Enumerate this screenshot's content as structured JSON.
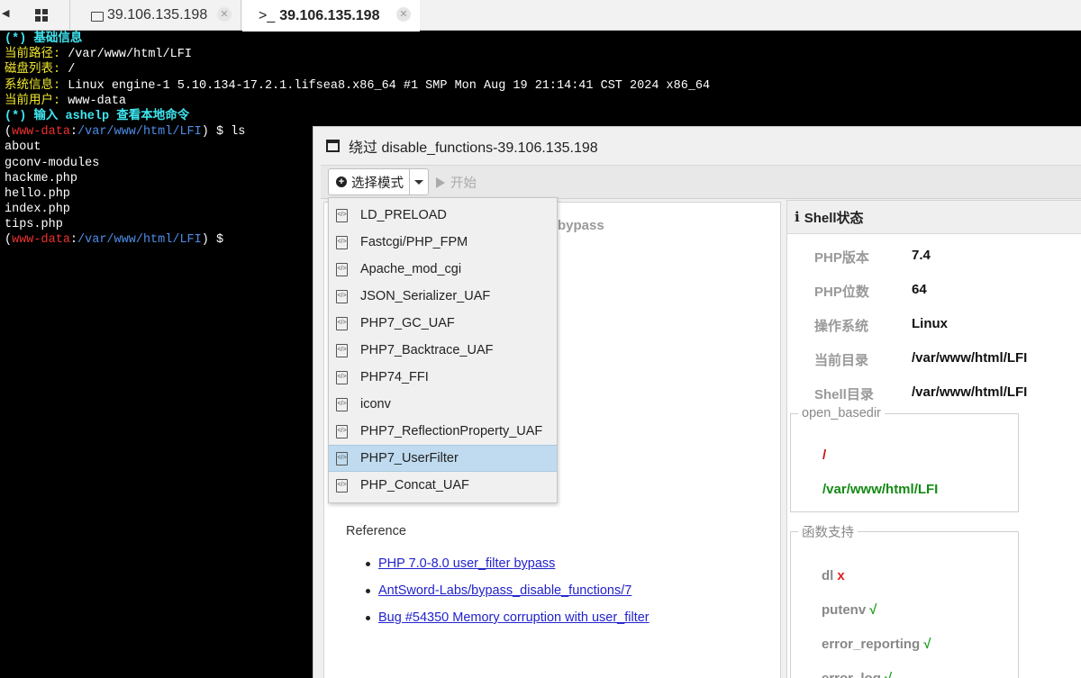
{
  "tabs": [
    {
      "label": "39.106.135.198",
      "icon": "folder-icon",
      "active": false
    },
    {
      "label": "39.106.135.198",
      "icon": "terminal-prompt-icon",
      "prefix": ">_",
      "active": true
    }
  ],
  "terminal": {
    "basic_info_header": "(*) 基础信息",
    "path_label": "当前路径:",
    "path_value": " /var/www/html/LFI",
    "disk_label": "磁盘列表:",
    "disk_value": " /",
    "sys_label": "系统信息:",
    "sys_value": " Linux engine-1 5.10.134-17.2.1.lifsea8.x86_64 #1 SMP Mon Aug 19 21:14:41 CST 2024 x86_64",
    "user_label": "当前用户:",
    "user_value": " www-data",
    "help_line": "(*) 输入 ashelp 查看本地命令",
    "prompt_user": "www-data",
    "prompt_path": "/var/www/html/LFI",
    "command": "ls",
    "ls_output": [
      "about",
      "gconv-modules",
      "hackme.php",
      "hello.php",
      "index.php",
      "tips.php"
    ]
  },
  "dialog": {
    "title": "绕过 disable_functions-39.106.135.198",
    "select_mode_label": "选择模式",
    "start_label": "开始",
    "bypass_partial": "bypass",
    "menu_items": [
      "LD_PRELOAD",
      "Fastcgi/PHP_FPM",
      "Apache_mod_cgi",
      "JSON_Serializer_UAF",
      "PHP7_GC_UAF",
      "PHP7_Backtrace_UAF",
      "PHP74_FFI",
      "iconv",
      "PHP7_ReflectionProperty_UAF",
      "PHP7_UserFilter",
      "PHP_Concat_UAF"
    ],
    "selected_menu_item": "PHP7_UserFilter",
    "reference_title": "Reference",
    "references": [
      "PHP 7.0-8.0 user_filter bypass",
      "AntSword-Labs/bypass_disable_functions/7",
      "Bug #54350 Memory corruption with user_filter"
    ]
  },
  "shell_status": {
    "header": "Shell状态",
    "rows": [
      {
        "key": "PHP版本",
        "value": "7.4"
      },
      {
        "key": "PHP位数",
        "value": "64"
      },
      {
        "key": "操作系统",
        "value": "Linux"
      },
      {
        "key": "当前目录",
        "value": "/var/www/html/LFI"
      },
      {
        "key": "Shell目录",
        "value": "/var/www/html/LFI"
      }
    ],
    "open_basedir_legend": "open_basedir",
    "open_basedir": [
      "/",
      "/var/www/html/LFI"
    ],
    "func_legend": "函数支持",
    "functions": [
      {
        "name": "dl",
        "mark": "x"
      },
      {
        "name": "putenv",
        "mark": "√"
      },
      {
        "name": "error_reporting",
        "mark": "√"
      },
      {
        "name": "error_log",
        "mark": "√"
      }
    ]
  },
  "colors": {
    "terminal_bg": "#000000",
    "cyan": "#3fe6f0",
    "yellow": "#f0e830",
    "prompt_red": "#ee3030",
    "prompt_blue": "#4e8ee8",
    "selected_item": "#c0dbef",
    "basedir_red": "#cc1010",
    "basedir_green": "#148a14"
  }
}
